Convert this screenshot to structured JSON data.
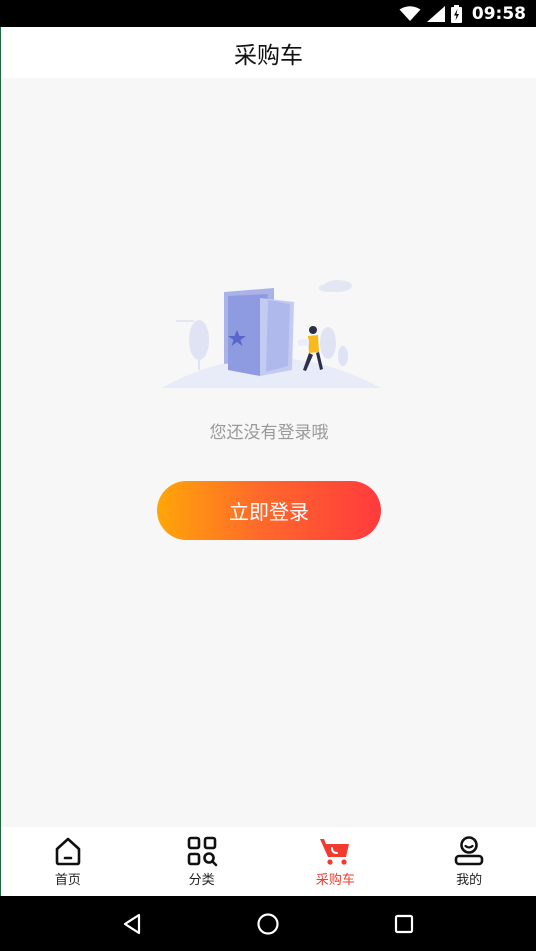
{
  "status_bar": {
    "time": "09:58",
    "icons": [
      "wifi-icon",
      "cellular-signal-icon",
      "battery-charging-icon"
    ]
  },
  "header": {
    "title": "采购车"
  },
  "empty_state": {
    "illustration": "empty-cart-illustration",
    "message": "您还没有登录哦",
    "login_button_label": "立即登录",
    "colors": {
      "gradient_start": "#ffa609",
      "gradient_end": "#ff3a3e"
    }
  },
  "tab_bar": {
    "items": [
      {
        "label": "首页",
        "icon": "home-icon",
        "active": false
      },
      {
        "label": "分类",
        "icon": "category-icon",
        "active": false
      },
      {
        "label": "采购车",
        "icon": "cart-icon",
        "active": true
      },
      {
        "label": "我的",
        "icon": "profile-icon",
        "active": false
      }
    ],
    "active_color": "#f23b30"
  },
  "nav_bar": {
    "buttons": [
      "back-icon",
      "home-circle-icon",
      "recents-icon"
    ]
  }
}
